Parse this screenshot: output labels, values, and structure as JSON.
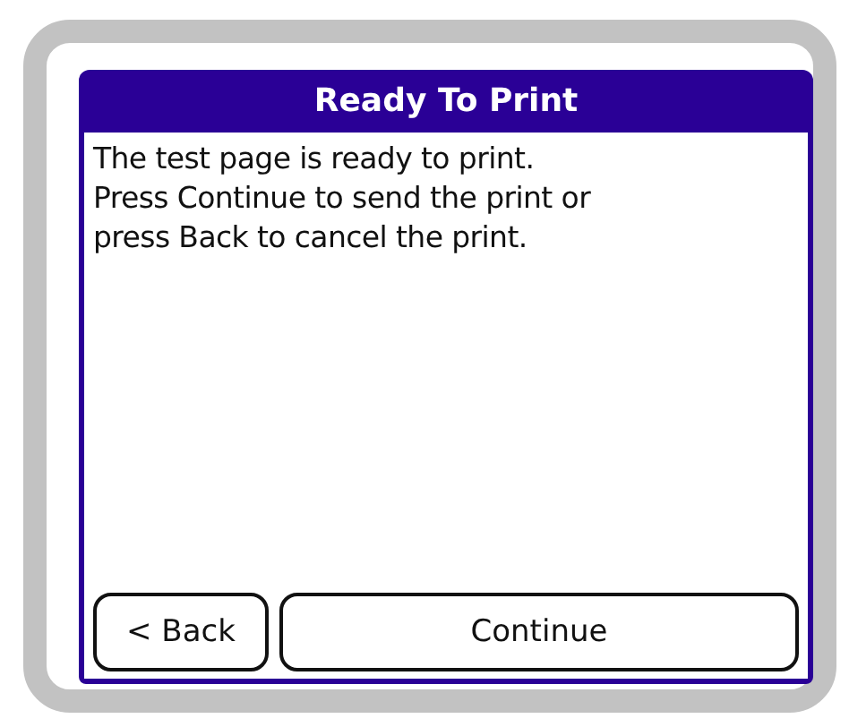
{
  "dialog": {
    "title": "Ready To Print",
    "message": [
      "The test page is ready to print.",
      "Press Continue to send the print or",
      "press Back to cancel the print."
    ]
  },
  "buttons": [
    {
      "label": "< Back",
      "kind": "back"
    },
    {
      "label": "Continue",
      "kind": "continue"
    }
  ]
}
